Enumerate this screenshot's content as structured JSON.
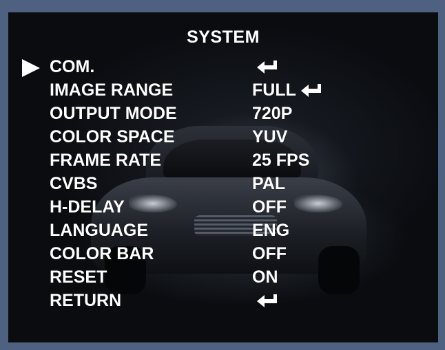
{
  "title": "SYSTEM",
  "menu": {
    "items": [
      {
        "label": "COM.",
        "value": "",
        "icon": "enter-icon"
      },
      {
        "label": "IMAGE RANGE",
        "value": "FULL",
        "icon": "enter-icon"
      },
      {
        "label": "OUTPUT MODE",
        "value": "720P"
      },
      {
        "label": "COLOR SPACE",
        "value": "YUV"
      },
      {
        "label": "FRAME RATE",
        "value": "25 FPS"
      },
      {
        "label": "CVBS",
        "value": "PAL"
      },
      {
        "label": "H-DELAY",
        "value": "OFF"
      },
      {
        "label": "LANGUAGE",
        "value": "ENG"
      },
      {
        "label": "COLOR BAR",
        "value": "OFF"
      },
      {
        "label": "RESET",
        "value": "ON"
      },
      {
        "label": "RETURN",
        "value": "",
        "icon": "enter-icon"
      }
    ],
    "selected_index": 0
  },
  "colors": {
    "frame": "#4e6180",
    "text": "#ffffff",
    "background": "#0a0c10"
  }
}
